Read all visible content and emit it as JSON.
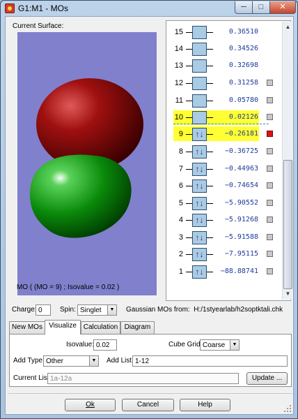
{
  "window": {
    "title": "G1:M1 - MOs"
  },
  "surface": {
    "label": "Current Surface:",
    "caption": "MO ( (MO = 9) ; Isovalue = 0.02 )"
  },
  "mo_list": [
    {
      "number": "15",
      "energy": "0.36510",
      "occupancy": "empty",
      "selectable": false,
      "highlighted": false
    },
    {
      "number": "14",
      "energy": "0.34526",
      "occupancy": "empty",
      "selectable": false,
      "highlighted": false
    },
    {
      "number": "13",
      "energy": "0.32698",
      "occupancy": "empty",
      "selectable": false,
      "highlighted": false
    },
    {
      "number": "12",
      "energy": "0.31258",
      "occupancy": "empty",
      "selectable": true,
      "highlighted": false
    },
    {
      "number": "11",
      "energy": "0.05780",
      "occupancy": "empty",
      "selectable": true,
      "highlighted": false
    },
    {
      "number": "10",
      "energy": "0.02126",
      "occupancy": "empty",
      "selectable": true,
      "highlighted": true
    },
    {
      "number": "9",
      "energy": "−0.26181",
      "occupancy": "paired",
      "selectable": true,
      "highlighted": true,
      "selected": true
    },
    {
      "number": "8",
      "energy": "−0.36725",
      "occupancy": "paired",
      "selectable": true,
      "highlighted": false
    },
    {
      "number": "7",
      "energy": "−0.44963",
      "occupancy": "paired",
      "selectable": true,
      "highlighted": false
    },
    {
      "number": "6",
      "energy": "−0.74654",
      "occupancy": "paired",
      "selectable": true,
      "highlighted": false
    },
    {
      "number": "5",
      "energy": "−5.90552",
      "occupancy": "paired",
      "selectable": true,
      "highlighted": false
    },
    {
      "number": "4",
      "energy": "−5.91268",
      "occupancy": "paired",
      "selectable": true,
      "highlighted": false
    },
    {
      "number": "3",
      "energy": "−5.91588",
      "occupancy": "paired",
      "selectable": true,
      "highlighted": false
    },
    {
      "number": "2",
      "energy": "−7.95115",
      "occupancy": "paired",
      "selectable": true,
      "highlighted": false
    },
    {
      "number": "1",
      "energy": "−88.88741",
      "occupancy": "paired",
      "selectable": true,
      "highlighted": false
    }
  ],
  "occupancy_glyph": {
    "paired": "↑↓",
    "empty": ""
  },
  "charge": {
    "label": "Charge:",
    "value": "0"
  },
  "spin": {
    "label": "Spin:",
    "value": "Singlet"
  },
  "source": {
    "label": "Gaussian MOs from:",
    "path": "H:/1styearlab/h2soptktali.chk"
  },
  "tabs": [
    {
      "label": "New MOs",
      "active": false
    },
    {
      "label": "Visualize",
      "active": true
    },
    {
      "label": "Calculation",
      "active": false
    },
    {
      "label": "Diagram",
      "active": false
    }
  ],
  "visualize": {
    "isovalue_label": "Isovalue:",
    "isovalue": "0.02",
    "cube_grid_label": "Cube Grid:",
    "cube_grid": "Coarse",
    "add_type_label": "Add Type:",
    "add_type": "Other",
    "add_list_label": "Add List:",
    "add_list": "1-12",
    "current_list_label": "Current List:",
    "current_list": "1a-12a",
    "update_button": "Update ..."
  },
  "buttons": {
    "ok": "Ok",
    "cancel": "Cancel",
    "help": "Help"
  },
  "colors": {
    "viewer_bg": "#8080cc",
    "lobe_positive": "#8b0000",
    "lobe_negative": "#0a8a0a",
    "highlight": "#ffff33",
    "selected": "#dd1111"
  }
}
